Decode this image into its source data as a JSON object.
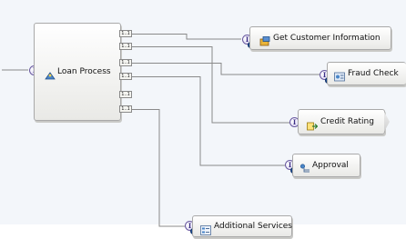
{
  "canvas": {
    "background": "#f3f6fa"
  },
  "process": {
    "label": "Loan Process",
    "interface_glyph": "I",
    "icon": "loan-process-icon"
  },
  "references": [
    {
      "label": "1..1"
    },
    {
      "label": "1..1"
    },
    {
      "label": "1..1"
    },
    {
      "label": "1..1"
    },
    {
      "label": "1..1"
    },
    {
      "label": "1..1"
    }
  ],
  "components": [
    {
      "label": "Get Customer Information",
      "icon": "java-component-icon",
      "interface_glyph": "I"
    },
    {
      "label": "Fraud Check",
      "icon": "state-machine-icon",
      "interface_glyph": "I"
    },
    {
      "label": "Credit Rating",
      "icon": "rule-group-icon",
      "interface_glyph": "I"
    },
    {
      "label": "Approval",
      "icon": "human-task-icon",
      "interface_glyph": "I"
    },
    {
      "label": "Additional Services",
      "icon": "selector-icon",
      "interface_glyph": "I"
    }
  ],
  "colors": {
    "wire": "#8a8a8a",
    "interface": "#6a5aa0",
    "error_marker": "#1d4e93"
  }
}
